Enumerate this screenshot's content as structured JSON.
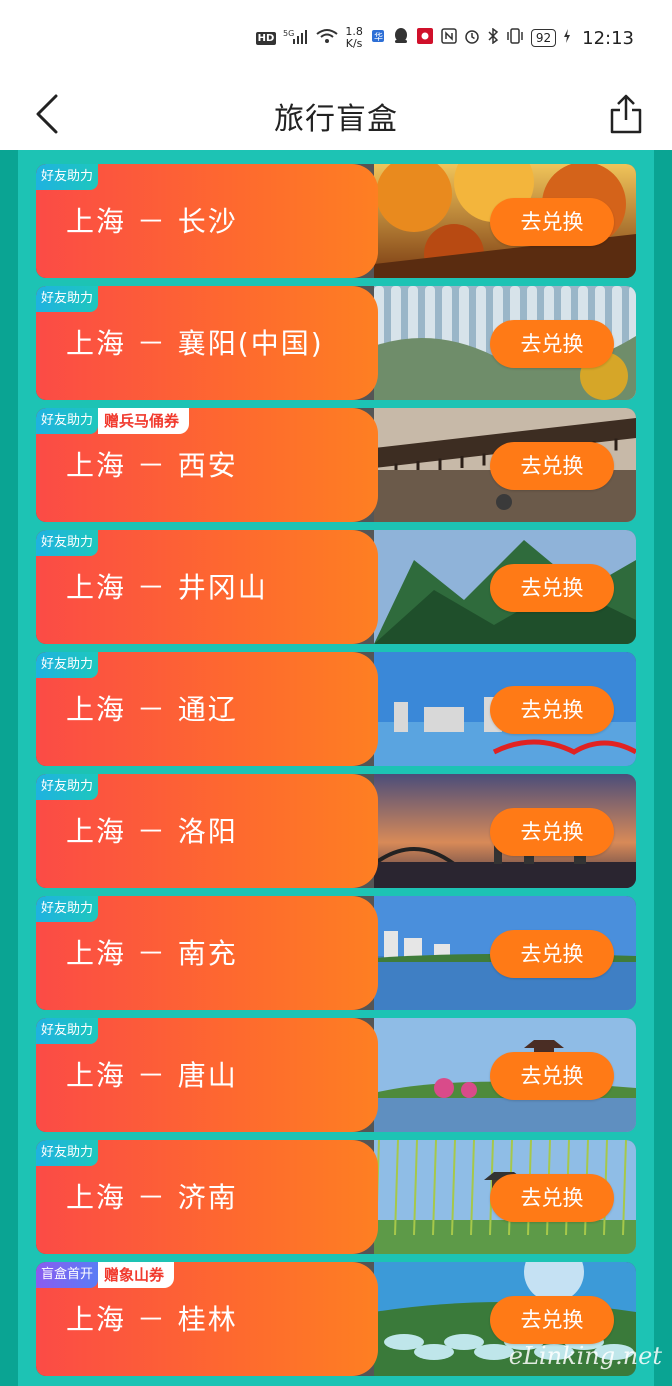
{
  "status": {
    "hd": "HD",
    "net": "5G",
    "speed_value": "1.8",
    "speed_unit": "K/s",
    "battery": "92",
    "time": "12:13"
  },
  "header": {
    "title": "旅行盲盒",
    "back_icon": "chevron-left-icon",
    "share_icon": "share-icon"
  },
  "cards": [
    {
      "tag": "好友助力",
      "gift": "",
      "route": "上海 － 长沙",
      "button": "去兑换",
      "scene": "autumn"
    },
    {
      "tag": "好友助力",
      "gift": "",
      "route": "上海 － 襄阳(中国)",
      "button": "去兑换",
      "scene": "cliff"
    },
    {
      "tag": "好友助力",
      "gift": "赠兵马俑券",
      "route": "上海 － 西安",
      "button": "去兑换",
      "scene": "eaves"
    },
    {
      "tag": "好友助力",
      "gift": "",
      "route": "上海 － 井冈山",
      "button": "去兑换",
      "scene": "mountain"
    },
    {
      "tag": "好友助力",
      "gift": "",
      "route": "上海 － 通辽",
      "button": "去兑换",
      "scene": "city"
    },
    {
      "tag": "好友助力",
      "gift": "",
      "route": "上海 － 洛阳",
      "button": "去兑换",
      "scene": "sunset"
    },
    {
      "tag": "好友助力",
      "gift": "",
      "route": "上海 － 南充",
      "button": "去兑换",
      "scene": "lake"
    },
    {
      "tag": "好友助力",
      "gift": "",
      "route": "上海 － 唐山",
      "button": "去兑换",
      "scene": "pagoda"
    },
    {
      "tag": "好友助力",
      "gift": "",
      "route": "上海 － 济南",
      "button": "去兑换",
      "scene": "willow"
    },
    {
      "tag": "盲盒首开",
      "gift": "赠象山券",
      "route": "上海 － 桂林",
      "button": "去兑换",
      "scene": "terraces"
    }
  ],
  "watermark": "eLinking.net",
  "colors": {
    "teal_outer": "#0aa493",
    "teal_inner": "#1dc3b4",
    "card_gradient_start": "#fb4b46",
    "card_gradient_end": "#fe7f22",
    "button": "#ff7a16",
    "gift_text": "#f13a2e"
  }
}
